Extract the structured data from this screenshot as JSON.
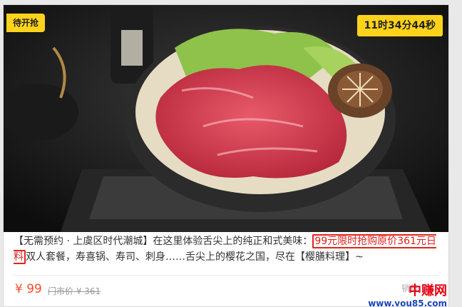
{
  "badge": {
    "label": "待开抢"
  },
  "countdown": {
    "text": "11时34分44秒"
  },
  "description": {
    "part1": "【无需预约 · 上虞区时代潮城】在这里体验舌尖上的纯正和式美味：",
    "highlight": "99元限时抢购原价361元日料",
    "part2": "双人套餐，寿喜锅、寿司、刺身……舌尖上的樱花之国，尽在【樱膳料理】~"
  },
  "pricing": {
    "price": "¥ 99",
    "original": "门市价 ¥ 361",
    "sold": "销售"
  },
  "watermark": {
    "brand": "中赚网",
    "url": "www.you85.com"
  },
  "colors": {
    "badge": "#ffd31c",
    "price": "#ff4a2a",
    "highlight_box": "#e1251b"
  }
}
